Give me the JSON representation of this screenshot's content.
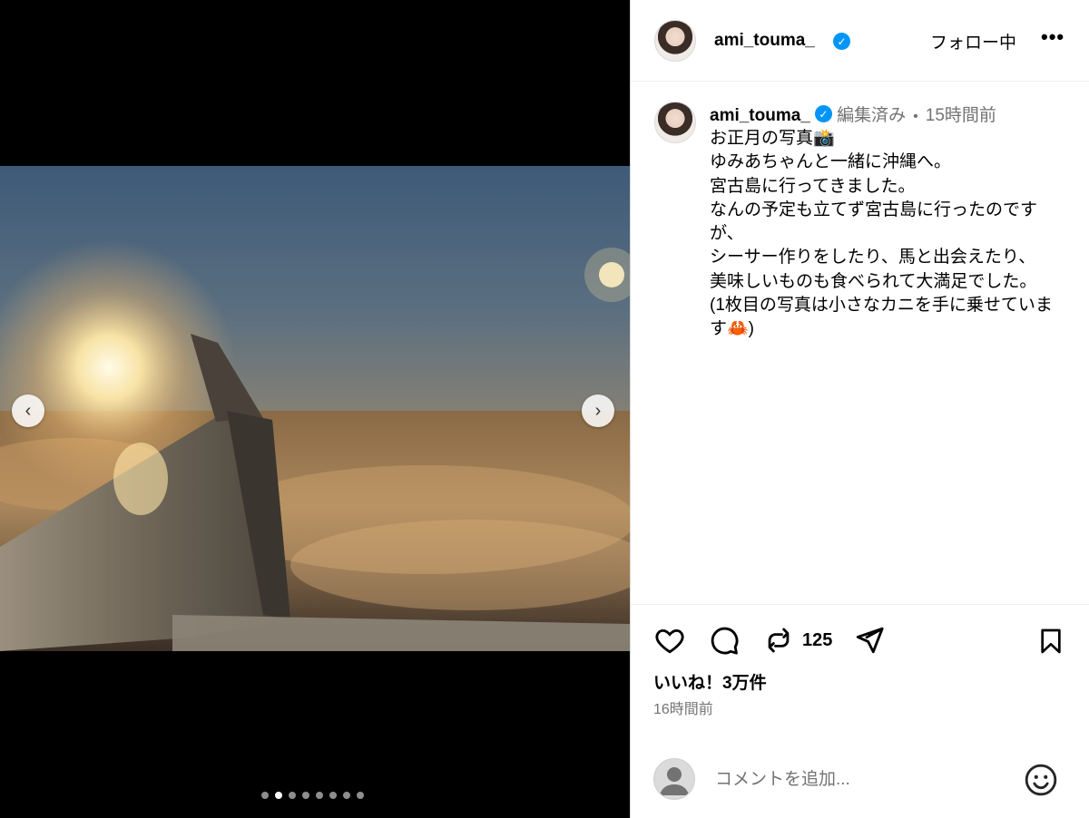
{
  "post": {
    "username": "ami_touma_",
    "follow_label": "フォロー中",
    "more_label": "•••",
    "carousel": {
      "current_index": 2,
      "total": 8
    }
  },
  "caption": {
    "username": "ami_touma_",
    "edited": "編集済み",
    "separator": "•",
    "time": "15時間前",
    "text": "お正月の写真📸\nゆみあちゃんと一緒に沖縄へ。\n宮古島に行ってきました。\nなんの予定も立てず宮古島に行ったのですが、\nシーサー作りをしたり、馬と出会えたり、\n美味しいものも食べられて大満足でした。\n(1枚目の写真は小さなカニを手に乗せています🦀)"
  },
  "actions": {
    "repost_count": "125",
    "likes": "いいね！3万件",
    "post_time": "16時間前"
  },
  "comment": {
    "placeholder": "コメントを追加..."
  },
  "colors": {
    "verified": "#0095f6",
    "secondary_text": "#737373",
    "border": "#dbdbdb"
  }
}
